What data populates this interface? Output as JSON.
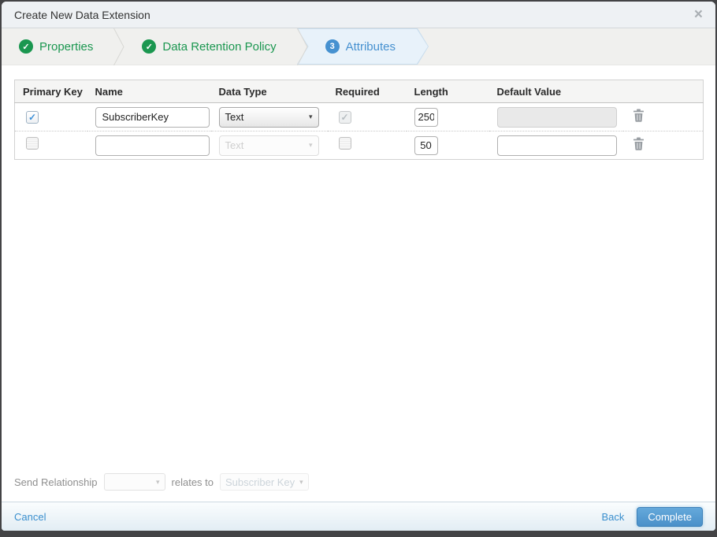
{
  "dialog": {
    "title": "Create New Data Extension"
  },
  "icons": {
    "close": "×",
    "check": "✓",
    "caret_down": "▾"
  },
  "wizard": {
    "steps": [
      {
        "label": "Properties",
        "status": "complete"
      },
      {
        "label": "Data Retention Policy",
        "status": "complete"
      },
      {
        "label": "Attributes",
        "status": "current",
        "number": "3"
      }
    ]
  },
  "attributes_table": {
    "headers": [
      "Primary Key",
      "Name",
      "Data Type",
      "Required",
      "Length",
      "Default Value",
      ""
    ],
    "rows": [
      {
        "primary_key": true,
        "name": "SubscriberKey",
        "data_type": "Text",
        "data_type_enabled": true,
        "required": true,
        "required_enabled": false,
        "length": "250",
        "default_value": "",
        "default_value_enabled": false
      },
      {
        "primary_key": false,
        "name": "",
        "data_type": "Text",
        "data_type_enabled": false,
        "required": false,
        "required_enabled": true,
        "length": "50",
        "default_value": "",
        "default_value_enabled": true
      }
    ]
  },
  "send_relationship": {
    "label": "Send Relationship",
    "field_value": "",
    "relates_to": "relates to",
    "target_value": "Subscriber Key"
  },
  "footer": {
    "cancel": "Cancel",
    "back": "Back",
    "complete": "Complete"
  },
  "colors": {
    "step_complete_green": "#1b9750",
    "step_current_blue": "#4691d0",
    "link_blue": "#3a8fce",
    "complete_button_blue": "#4a90c9",
    "active_step_bg": "#e8f2fa"
  }
}
